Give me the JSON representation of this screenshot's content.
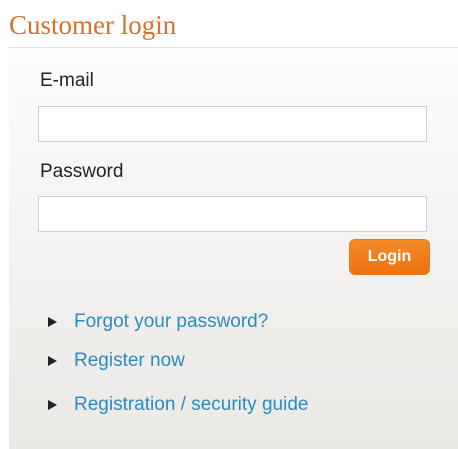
{
  "login": {
    "title": "Customer login",
    "email_label": "E-mail",
    "email_value": "",
    "password_label": "Password",
    "password_value": "",
    "login_button": "Login",
    "links": [
      {
        "label": "Forgot your password?",
        "icon": "triangle-right-icon"
      },
      {
        "label": "Register now",
        "icon": "triangle-right-icon"
      },
      {
        "label": "Registration / security guide",
        "icon": "triangle-right-icon"
      }
    ]
  },
  "colors": {
    "title": "#d9702b",
    "link": "#2a8bbf",
    "button": "#ec7112",
    "button_text": "#ffffff",
    "label": "#222222"
  }
}
